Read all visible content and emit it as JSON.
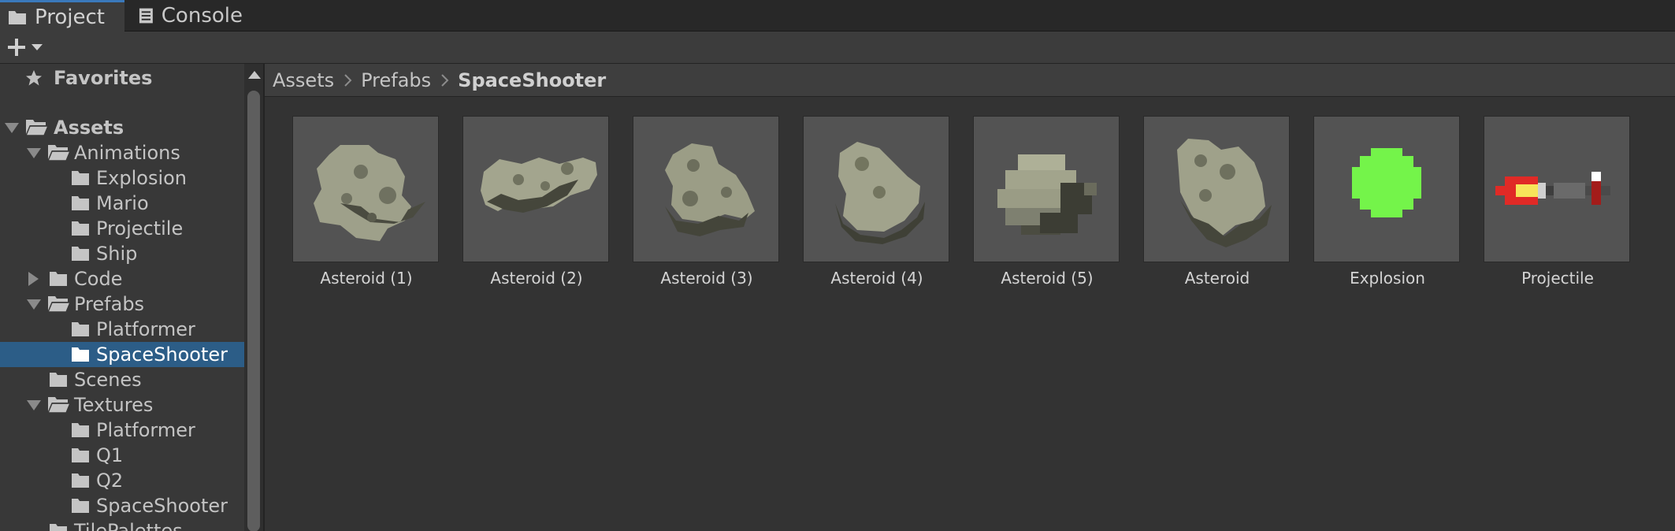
{
  "tabs": [
    {
      "label": "Project",
      "icon": "folder-icon",
      "active": true
    },
    {
      "label": "Console",
      "icon": "console-icon",
      "active": false
    }
  ],
  "toolbar": {
    "add_icon": "plus-icon",
    "dropdown_icon": "dropdown-arrow-icon"
  },
  "sidebar": {
    "favorites": "Favorites",
    "tree": [
      {
        "label": "Assets",
        "bold": true
      },
      {
        "label": "Animations"
      },
      {
        "label": "Explosion"
      },
      {
        "label": "Mario"
      },
      {
        "label": "Projectile"
      },
      {
        "label": "Ship"
      },
      {
        "label": "Code"
      },
      {
        "label": "Prefabs"
      },
      {
        "label": "Platformer"
      },
      {
        "label": "SpaceShooter",
        "selected": true
      },
      {
        "label": "Scenes"
      },
      {
        "label": "Textures"
      },
      {
        "label": "Platformer"
      },
      {
        "label": "Q1"
      },
      {
        "label": "Q2"
      },
      {
        "label": "SpaceShooter"
      },
      {
        "label": "TilePalettes"
      }
    ]
  },
  "breadcrumb": [
    "Assets",
    "Prefabs",
    "SpaceShooter"
  ],
  "assets": [
    {
      "label": "Asteroid (1)",
      "icon": "asteroid-icon"
    },
    {
      "label": "Asteroid (2)",
      "icon": "asteroid-icon"
    },
    {
      "label": "Asteroid (3)",
      "icon": "asteroid-icon"
    },
    {
      "label": "Asteroid (4)",
      "icon": "asteroid-icon"
    },
    {
      "label": "Asteroid (5)",
      "icon": "asteroid-icon"
    },
    {
      "label": "Asteroid",
      "icon": "asteroid-icon"
    },
    {
      "label": "Explosion",
      "icon": "explosion-icon"
    },
    {
      "label": "Projectile",
      "icon": "projectile-icon"
    }
  ],
  "colors": {
    "selection": "#2c5d87",
    "active_tab_accent": "#3a79bb",
    "explosion_green": "#74f44a",
    "projectile_red": "#e02a26"
  }
}
